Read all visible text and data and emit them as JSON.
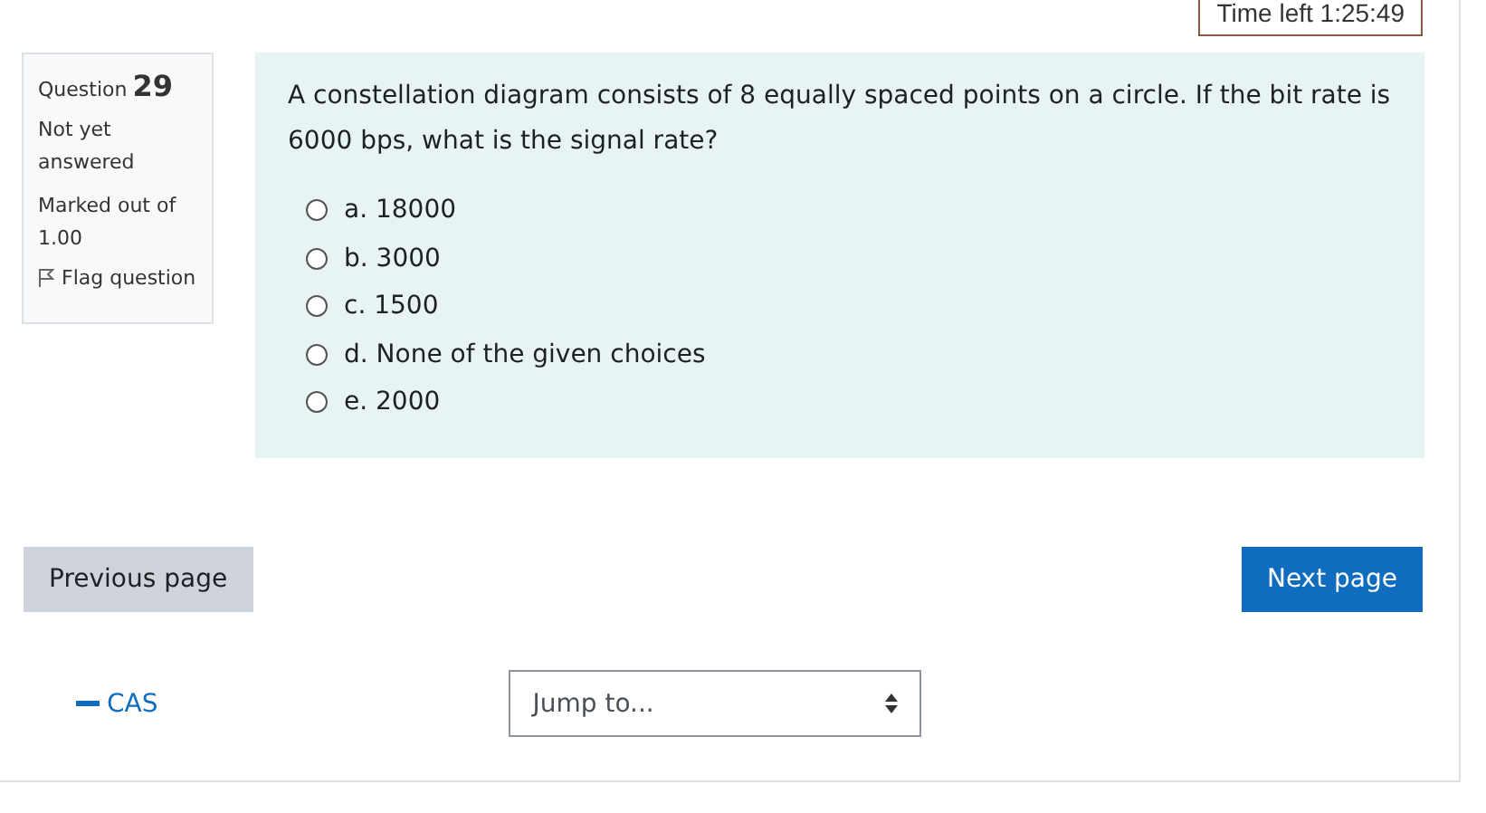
{
  "timer": "Time left 1:25:49",
  "question_info": {
    "label": "Question",
    "number": "29",
    "state": "Not yet answered",
    "marks": "Marked out of 1.00",
    "flag": "Flag question",
    "flagged": false
  },
  "question": {
    "text": "A constellation diagram consists of 8 equally spaced points on a circle. If the bit rate is 6000 bps, what is the signal rate?",
    "options": [
      {
        "label": "a. 18000",
        "selected": false
      },
      {
        "label": "b. 3000",
        "selected": false
      },
      {
        "label": "c. 1500",
        "selected": false
      },
      {
        "label": "d. None of the given choices",
        "selected": false
      },
      {
        "label": "e. 2000",
        "selected": false
      }
    ]
  },
  "buttons": {
    "previous": "Previous page",
    "next": "Next page"
  },
  "nav": {
    "back_link": "CAS",
    "jump": {
      "placeholder": "Jump to..."
    }
  }
}
